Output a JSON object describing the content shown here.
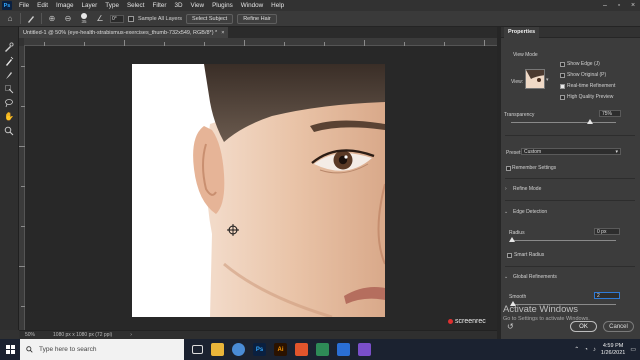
{
  "app": {
    "logo_text": "Ps",
    "menu": [
      "File",
      "Edit",
      "Image",
      "Layer",
      "Type",
      "Select",
      "Filter",
      "3D",
      "View",
      "Plugins",
      "Window",
      "Help"
    ]
  },
  "options_bar": {
    "brush_size": "35",
    "angle_value": "0°",
    "sample_all_layers": "Sample All Layers",
    "select_subject": "Select Subject",
    "refine_hair": "Refine Hair"
  },
  "document": {
    "tab_title": "Untitled-1 @ 50% (eye-health-strabismus-exercises_thumb-732x549, RGB/8*) *",
    "close_glyph": "×",
    "zoom": "50%",
    "doc_info": "1080 px x 1080 px (72 ppi)"
  },
  "properties": {
    "tab": "Properties",
    "view_mode": "View Mode",
    "view_label": "View:",
    "show_edge": "Show Edge (J)",
    "show_original": "Show Original (P)",
    "realtime_refinement": "Real-time Refinement",
    "high_quality_preview": "High Quality Preview",
    "transparency_label": "Transparency",
    "transparency_value": "75%",
    "transparency_fraction": 0.75,
    "preset_label": "Preset:",
    "preset_value": "Custom",
    "remember_settings": "Remember Settings",
    "refine_mode": "Refine Mode",
    "edge_detection": "Edge Detection",
    "radius_label": "Radius",
    "radius_value": "0 px",
    "smart_radius": "Smart Radius",
    "global_refinements": "Global Refinements",
    "smooth_label": "Smooth",
    "smooth_value": "2",
    "ok": "OK",
    "cancel": "Cancel"
  },
  "activation": {
    "title": "Activate Windows",
    "subtitle": "Go to Settings to activate Windows."
  },
  "watermark": "screenrec",
  "taskbar": {
    "search_placeholder": "Type here to search",
    "time": "4:59 PM",
    "date": "1/26/2021"
  }
}
